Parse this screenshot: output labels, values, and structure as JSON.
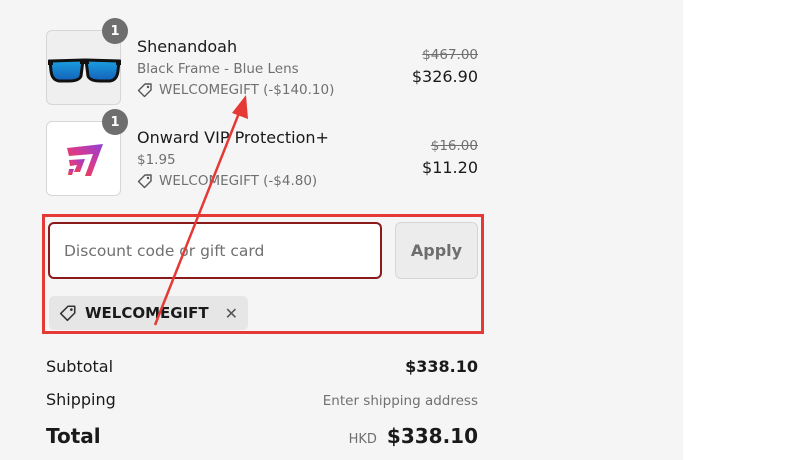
{
  "items": [
    {
      "quantity": "1",
      "title": "Shenandoah",
      "variant": "Black Frame - Blue Lens",
      "discount": "WELCOMEGIFT (-$140.10)",
      "price_original": "$467.00",
      "price_final": "$326.90",
      "image": "sunglasses-product-image"
    },
    {
      "quantity": "1",
      "title": "Onward VIP Protection+",
      "variant": "$1.95",
      "discount": "WELCOMEGIFT (-$4.80)",
      "price_original": "$16.00",
      "price_final": "$11.20",
      "image": "onward-logo-image"
    }
  ],
  "discount": {
    "placeholder": "Discount code or gift card",
    "apply_label": "Apply",
    "applied_code": "WELCOMEGIFT"
  },
  "summary": {
    "subtotal_label": "Subtotal",
    "subtotal_value": "$338.10",
    "shipping_label": "Shipping",
    "shipping_value": "Enter shipping address",
    "total_label": "Total",
    "currency": "HKD",
    "total_value": "$338.10"
  },
  "colors": {
    "highlight_box": "#e53935",
    "annotation_arrow": "#e53935",
    "input_focus_border": "#8b1a1a"
  }
}
